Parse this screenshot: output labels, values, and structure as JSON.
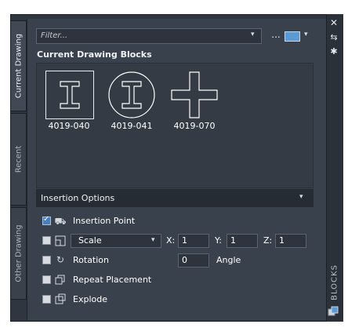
{
  "tabs": {
    "current_drawing": "Current Drawing",
    "recent": "Recent",
    "other_drawing": "Other Drawing"
  },
  "filter": {
    "placeholder": "Filter...",
    "more": "...",
    "chevron": "▾"
  },
  "section_title": "Current Drawing Blocks",
  "blocks": [
    {
      "name": "4019-040",
      "icon": "i-beam-icon"
    },
    {
      "name": "4019-041",
      "icon": "i-beam-circle-icon"
    },
    {
      "name": "4019-070",
      "icon": "cross-icon"
    }
  ],
  "insertion_options": {
    "title": "Insertion Options",
    "insertion_point": {
      "label": "Insertion Point",
      "checked": true
    },
    "scale": {
      "mode": "Scale",
      "checked": false,
      "x_label": "X:",
      "x": "1",
      "y_label": "Y:",
      "y": "1",
      "z_label": "Z:",
      "z": "1"
    },
    "rotation": {
      "label": "Rotation",
      "checked": false,
      "value": "0",
      "angle_label": "Angle"
    },
    "repeat_placement": {
      "label": "Repeat Placement",
      "checked": false
    },
    "explode": {
      "label": "Explode",
      "checked": false
    }
  },
  "palette": {
    "title": "BLOCKS",
    "close": "✕",
    "autohide": "⇆",
    "settings": "✱"
  },
  "colors": {
    "accent": "#5b9bd5",
    "panel": "#39414c",
    "dark": "#262c34"
  }
}
